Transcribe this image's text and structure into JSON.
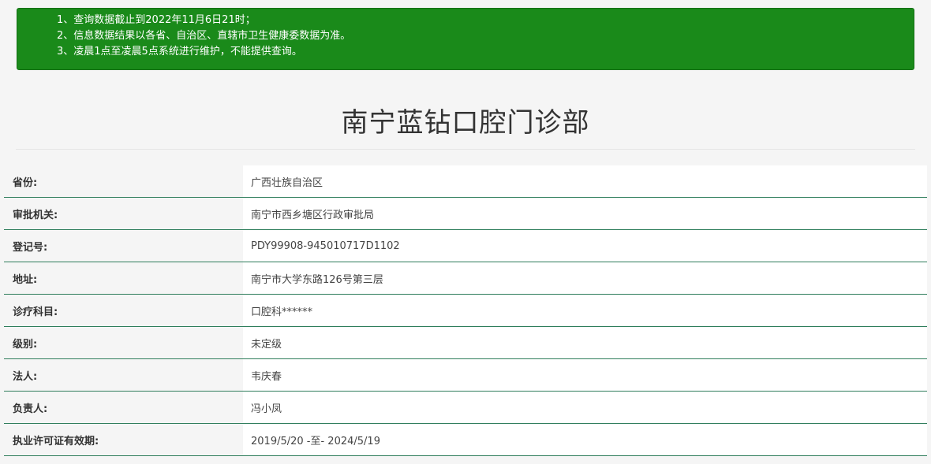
{
  "notice": {
    "lines": [
      "1、查询数据截止到2022年11月6日21时；",
      "2、信息数据结果以各省、自治区、直辖市卫生健康委数据为准。",
      "3、凌晨1点至凌晨5点系统进行维护，不能提供查询。"
    ],
    "bg_color": "#1a8a1a"
  },
  "title": "南宁蓝钻口腔门诊部",
  "rows": [
    {
      "label": "省份:",
      "value": "广西壮族自治区"
    },
    {
      "label": "审批机关:",
      "value": "南宁市西乡塘区行政审批局"
    },
    {
      "label": "登记号:",
      "value": "PDY99908-945010717D1102"
    },
    {
      "label": "地址:",
      "value": "南宁市大学东路126号第三层"
    },
    {
      "label": "诊疗科目:",
      "value": "口腔科******"
    },
    {
      "label": "级别:",
      "value": "未定级"
    },
    {
      "label": "法人:",
      "value": "韦庆春"
    },
    {
      "label": "负责人:",
      "value": "冯小凤"
    },
    {
      "label": "执业许可证有效期:",
      "value": "2019/5/20 -至- 2024/5/19"
    }
  ],
  "colors": {
    "row_border": "#2e7d5b",
    "label_bg": "#f5f5f5",
    "value_bg": "#ffffff"
  }
}
